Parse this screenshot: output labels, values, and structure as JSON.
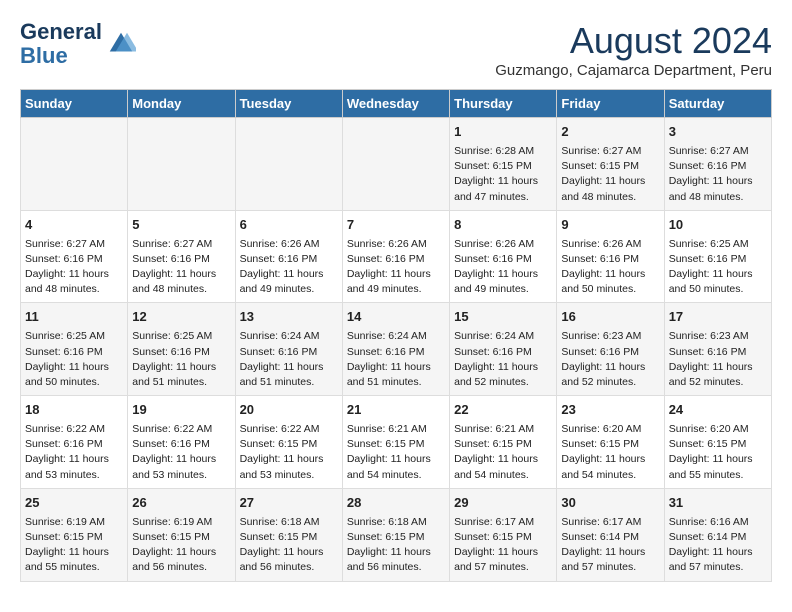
{
  "header": {
    "logo_line1": "General",
    "logo_line2": "Blue",
    "main_title": "August 2024",
    "subtitle": "Guzmango, Cajamarca Department, Peru"
  },
  "calendar": {
    "days_of_week": [
      "Sunday",
      "Monday",
      "Tuesday",
      "Wednesday",
      "Thursday",
      "Friday",
      "Saturday"
    ],
    "weeks": [
      [
        {
          "day": "",
          "content": ""
        },
        {
          "day": "",
          "content": ""
        },
        {
          "day": "",
          "content": ""
        },
        {
          "day": "",
          "content": ""
        },
        {
          "day": "1",
          "content": "Sunrise: 6:28 AM\nSunset: 6:15 PM\nDaylight: 11 hours\nand 47 minutes."
        },
        {
          "day": "2",
          "content": "Sunrise: 6:27 AM\nSunset: 6:15 PM\nDaylight: 11 hours\nand 48 minutes."
        },
        {
          "day": "3",
          "content": "Sunrise: 6:27 AM\nSunset: 6:16 PM\nDaylight: 11 hours\nand 48 minutes."
        }
      ],
      [
        {
          "day": "4",
          "content": "Sunrise: 6:27 AM\nSunset: 6:16 PM\nDaylight: 11 hours\nand 48 minutes."
        },
        {
          "day": "5",
          "content": "Sunrise: 6:27 AM\nSunset: 6:16 PM\nDaylight: 11 hours\nand 48 minutes."
        },
        {
          "day": "6",
          "content": "Sunrise: 6:26 AM\nSunset: 6:16 PM\nDaylight: 11 hours\nand 49 minutes."
        },
        {
          "day": "7",
          "content": "Sunrise: 6:26 AM\nSunset: 6:16 PM\nDaylight: 11 hours\nand 49 minutes."
        },
        {
          "day": "8",
          "content": "Sunrise: 6:26 AM\nSunset: 6:16 PM\nDaylight: 11 hours\nand 49 minutes."
        },
        {
          "day": "9",
          "content": "Sunrise: 6:26 AM\nSunset: 6:16 PM\nDaylight: 11 hours\nand 50 minutes."
        },
        {
          "day": "10",
          "content": "Sunrise: 6:25 AM\nSunset: 6:16 PM\nDaylight: 11 hours\nand 50 minutes."
        }
      ],
      [
        {
          "day": "11",
          "content": "Sunrise: 6:25 AM\nSunset: 6:16 PM\nDaylight: 11 hours\nand 50 minutes."
        },
        {
          "day": "12",
          "content": "Sunrise: 6:25 AM\nSunset: 6:16 PM\nDaylight: 11 hours\nand 51 minutes."
        },
        {
          "day": "13",
          "content": "Sunrise: 6:24 AM\nSunset: 6:16 PM\nDaylight: 11 hours\nand 51 minutes."
        },
        {
          "day": "14",
          "content": "Sunrise: 6:24 AM\nSunset: 6:16 PM\nDaylight: 11 hours\nand 51 minutes."
        },
        {
          "day": "15",
          "content": "Sunrise: 6:24 AM\nSunset: 6:16 PM\nDaylight: 11 hours\nand 52 minutes."
        },
        {
          "day": "16",
          "content": "Sunrise: 6:23 AM\nSunset: 6:16 PM\nDaylight: 11 hours\nand 52 minutes."
        },
        {
          "day": "17",
          "content": "Sunrise: 6:23 AM\nSunset: 6:16 PM\nDaylight: 11 hours\nand 52 minutes."
        }
      ],
      [
        {
          "day": "18",
          "content": "Sunrise: 6:22 AM\nSunset: 6:16 PM\nDaylight: 11 hours\nand 53 minutes."
        },
        {
          "day": "19",
          "content": "Sunrise: 6:22 AM\nSunset: 6:16 PM\nDaylight: 11 hours\nand 53 minutes."
        },
        {
          "day": "20",
          "content": "Sunrise: 6:22 AM\nSunset: 6:15 PM\nDaylight: 11 hours\nand 53 minutes."
        },
        {
          "day": "21",
          "content": "Sunrise: 6:21 AM\nSunset: 6:15 PM\nDaylight: 11 hours\nand 54 minutes."
        },
        {
          "day": "22",
          "content": "Sunrise: 6:21 AM\nSunset: 6:15 PM\nDaylight: 11 hours\nand 54 minutes."
        },
        {
          "day": "23",
          "content": "Sunrise: 6:20 AM\nSunset: 6:15 PM\nDaylight: 11 hours\nand 54 minutes."
        },
        {
          "day": "24",
          "content": "Sunrise: 6:20 AM\nSunset: 6:15 PM\nDaylight: 11 hours\nand 55 minutes."
        }
      ],
      [
        {
          "day": "25",
          "content": "Sunrise: 6:19 AM\nSunset: 6:15 PM\nDaylight: 11 hours\nand 55 minutes."
        },
        {
          "day": "26",
          "content": "Sunrise: 6:19 AM\nSunset: 6:15 PM\nDaylight: 11 hours\nand 56 minutes."
        },
        {
          "day": "27",
          "content": "Sunrise: 6:18 AM\nSunset: 6:15 PM\nDaylight: 11 hours\nand 56 minutes."
        },
        {
          "day": "28",
          "content": "Sunrise: 6:18 AM\nSunset: 6:15 PM\nDaylight: 11 hours\nand 56 minutes."
        },
        {
          "day": "29",
          "content": "Sunrise: 6:17 AM\nSunset: 6:15 PM\nDaylight: 11 hours\nand 57 minutes."
        },
        {
          "day": "30",
          "content": "Sunrise: 6:17 AM\nSunset: 6:14 PM\nDaylight: 11 hours\nand 57 minutes."
        },
        {
          "day": "31",
          "content": "Sunrise: 6:16 AM\nSunset: 6:14 PM\nDaylight: 11 hours\nand 57 minutes."
        }
      ]
    ]
  }
}
